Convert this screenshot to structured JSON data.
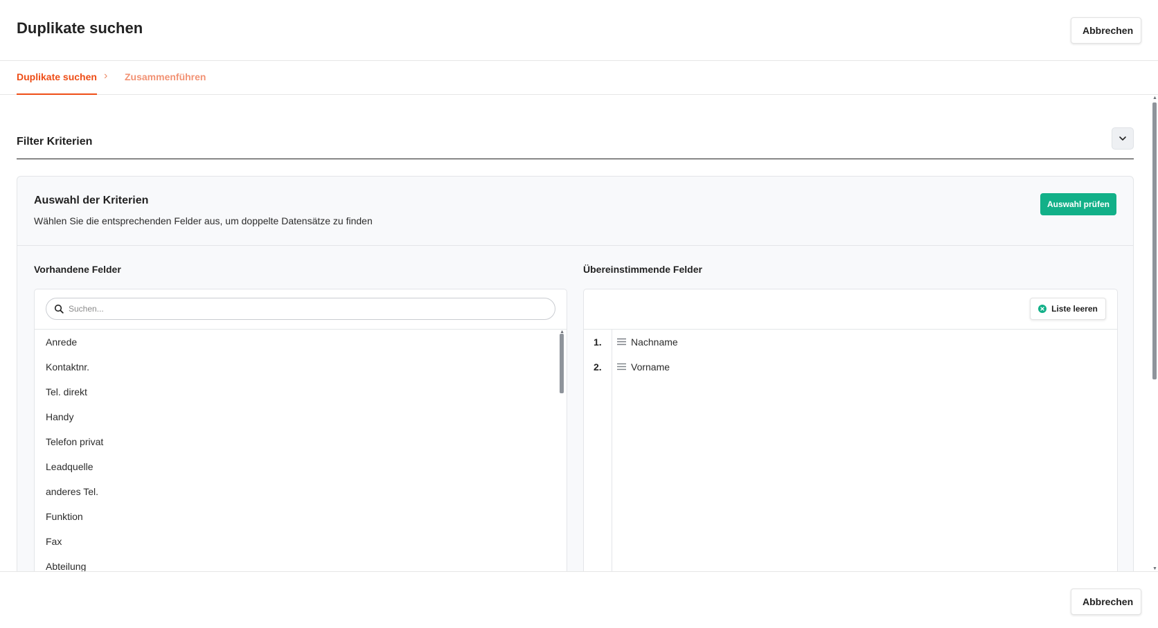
{
  "header": {
    "title": "Duplikate suchen",
    "cancel_label": "Abbrechen"
  },
  "stepper": {
    "steps": [
      {
        "label": "Duplikate suchen",
        "active": true
      },
      {
        "label": "Zusammenführen",
        "active": false
      }
    ],
    "separator": "›"
  },
  "filter_section": {
    "title": "Filter Kriterien"
  },
  "criteria": {
    "title": "Auswahl der Kriterien",
    "description": "Wählen Sie die entsprechenden Felder aus, um doppelte Datensätze zu finden",
    "check_button": "Auswahl prüfen"
  },
  "available_fields": {
    "label": "Vorhandene Felder",
    "search_placeholder": "Suchen...",
    "items": [
      "Anrede",
      "Kontaktnr.",
      "Tel. direkt",
      "Handy",
      "Telefon privat",
      "Leadquelle",
      "anderes Tel.",
      "Funktion",
      "Fax",
      "Abteilung"
    ]
  },
  "matching_fields": {
    "label": "Übereinstimmende Felder",
    "clear_button": "Liste leeren",
    "items": [
      {
        "num": "1.",
        "label": "Nachname"
      },
      {
        "num": "2.",
        "label": "Vorname"
      }
    ]
  },
  "footer": {
    "cancel_label": "Abbrechen"
  },
  "colors": {
    "accent": "#ee4d16",
    "accent_light": "#f29274",
    "success": "#12b088"
  },
  "icons": {
    "search": "search-icon",
    "collapse": "chevron-down-icon",
    "clear": "close-circle-icon",
    "drag": "drag-handle-icon"
  }
}
